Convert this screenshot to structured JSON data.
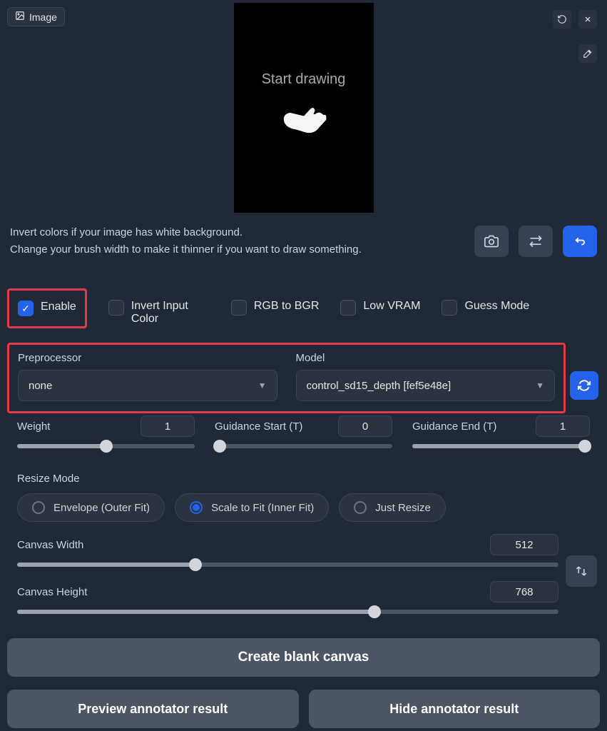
{
  "tab": {
    "label": "Image"
  },
  "canvas_preview": {
    "text": "Start drawing"
  },
  "hints": {
    "line1": "Invert colors if your image has white background.",
    "line2": "Change your brush width to make it thinner if you want to draw something."
  },
  "checkboxes": {
    "enable": {
      "label": "Enable",
      "checked": true
    },
    "invert": {
      "label": "Invert Input Color",
      "checked": false
    },
    "rgb2bgr": {
      "label": "RGB to BGR",
      "checked": false
    },
    "lowvram": {
      "label": "Low VRAM",
      "checked": false
    },
    "guess": {
      "label": "Guess Mode",
      "checked": false
    }
  },
  "preprocessor": {
    "label": "Preprocessor",
    "value": "none"
  },
  "model": {
    "label": "Model",
    "value": "control_sd15_depth [fef5e48e]"
  },
  "weight": {
    "label": "Weight",
    "value": "1",
    "pct": 50
  },
  "guidance_start": {
    "label": "Guidance Start (T)",
    "value": "0",
    "pct": 0
  },
  "guidance_end": {
    "label": "Guidance End (T)",
    "value": "1",
    "pct": 100
  },
  "resize": {
    "label": "Resize Mode",
    "options": [
      "Envelope (Outer Fit)",
      "Scale to Fit (Inner Fit)",
      "Just Resize"
    ],
    "selected": 1
  },
  "canvas_width": {
    "label": "Canvas Width",
    "value": "512",
    "pct": 33
  },
  "canvas_height": {
    "label": "Canvas Height",
    "value": "768",
    "pct": 66
  },
  "buttons": {
    "create": "Create blank canvas",
    "preview": "Preview annotator result",
    "hide": "Hide annotator result"
  }
}
